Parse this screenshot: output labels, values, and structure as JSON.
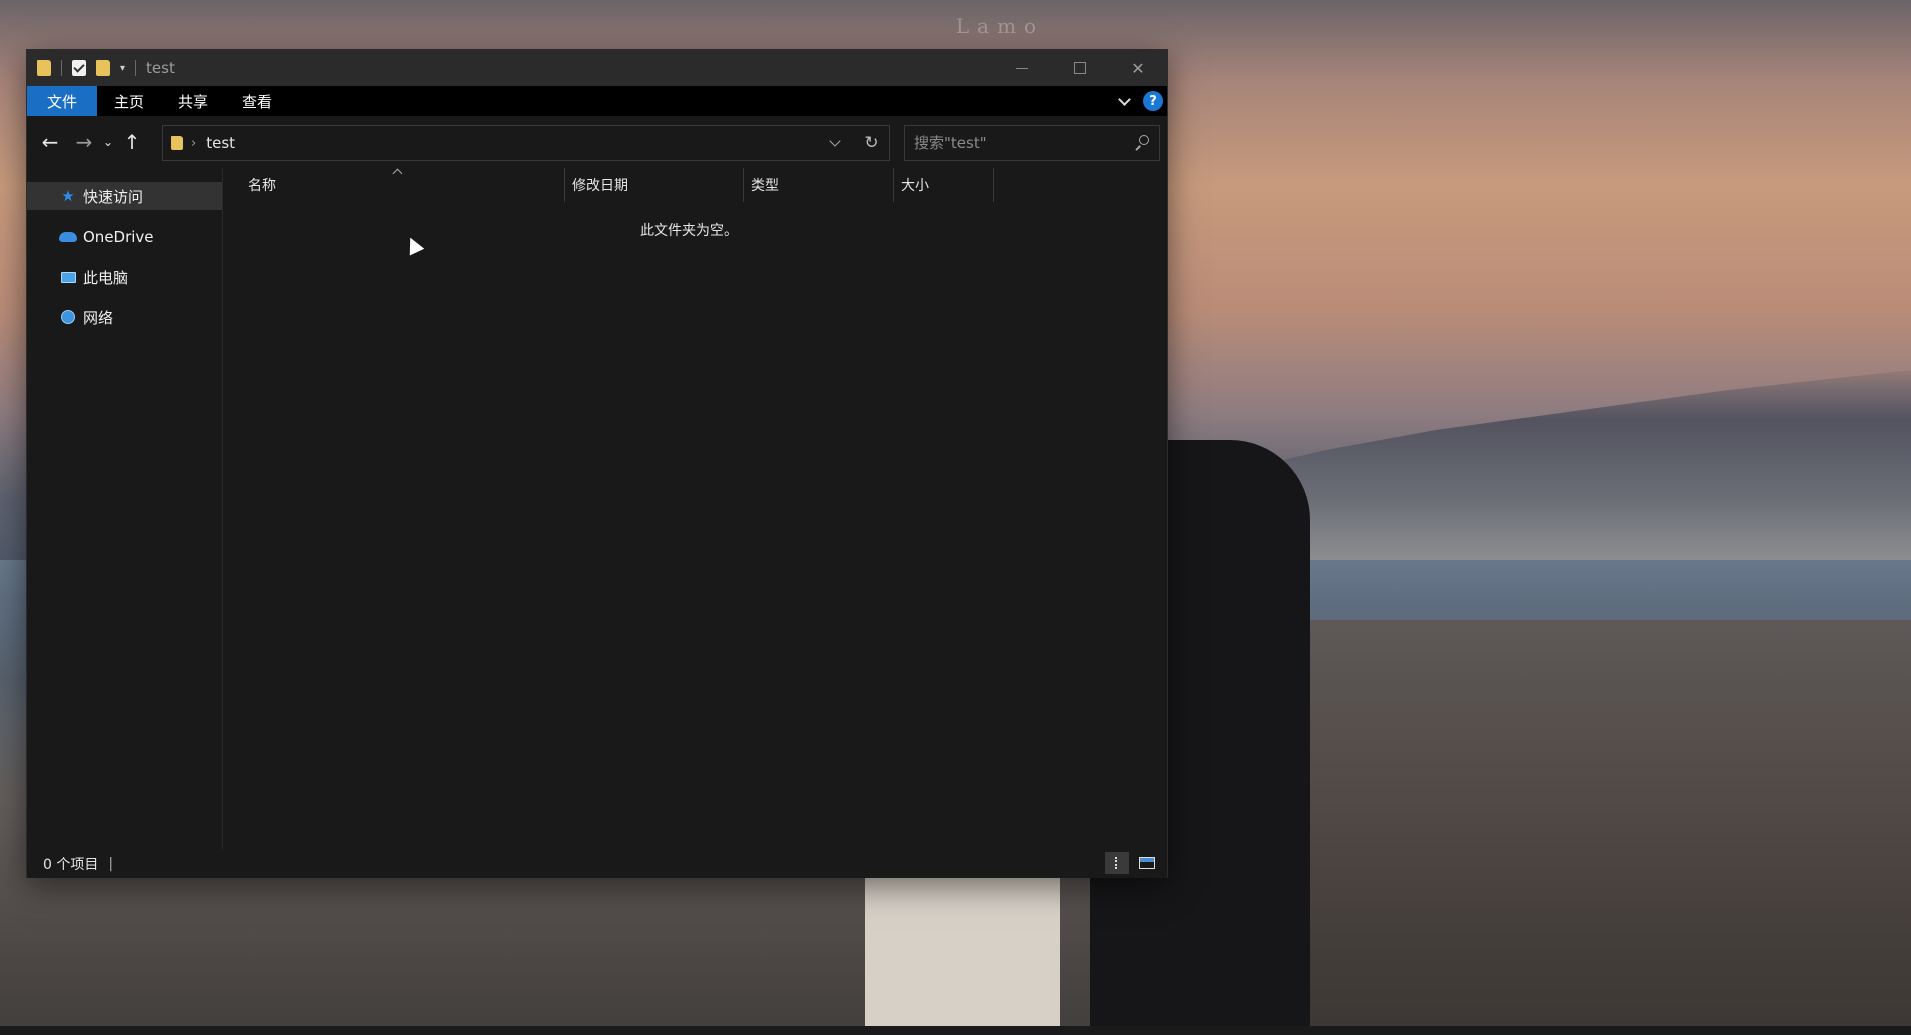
{
  "desktop": {
    "watermark": "Lamo"
  },
  "window": {
    "title": "test",
    "quick_access_icons": [
      "folder-icon",
      "properties-check-icon",
      "new-folder-icon",
      "customize-dropdown-icon"
    ]
  },
  "ribbon": {
    "tabs": [
      {
        "label": "文件",
        "active": true
      },
      {
        "label": "主页"
      },
      {
        "label": "共享"
      },
      {
        "label": "查看"
      }
    ],
    "help_label": "?"
  },
  "navigation": {
    "back_icon": "←",
    "forward_icon": "→",
    "recent_icon": "⌄",
    "up_icon": "↑",
    "address_path": "test",
    "refresh_icon": "↻",
    "search_placeholder": "搜索\"test\""
  },
  "sidebar": {
    "items": [
      {
        "label": "快速访问",
        "icon": "star-icon",
        "active": true
      },
      {
        "label": "OneDrive",
        "icon": "cloud-icon"
      },
      {
        "label": "此电脑",
        "icon": "computer-icon"
      },
      {
        "label": "网络",
        "icon": "network-icon"
      }
    ]
  },
  "content": {
    "columns": [
      "名称",
      "修改日期",
      "类型",
      "大小"
    ],
    "empty_message": "此文件夹为空。"
  },
  "status": {
    "item_count": "0 个项目"
  },
  "colors": {
    "accent": "#1a6fc4",
    "background": "#191919",
    "titlebar": "#2b2b2b",
    "ribbon": "#000000"
  }
}
